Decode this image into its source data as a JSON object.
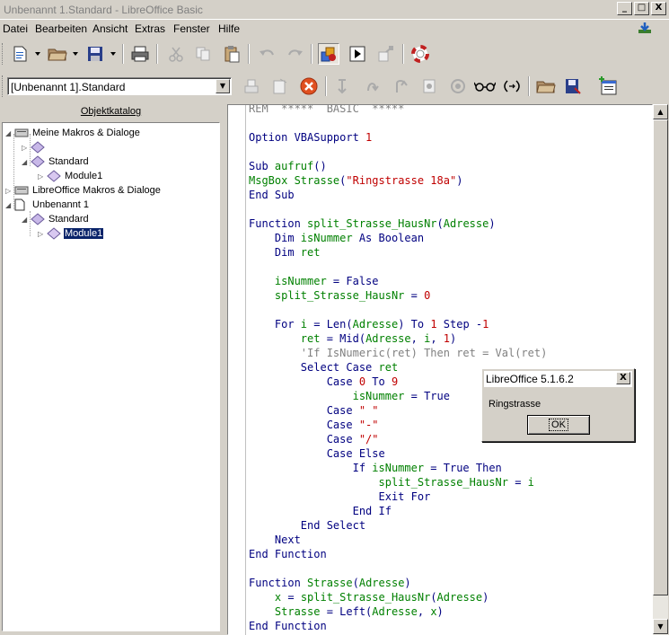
{
  "window": {
    "title": "Unbenannt 1.Standard - LibreOffice Basic",
    "controls": {
      "minimize": "_",
      "maximize": "□",
      "close": "X"
    }
  },
  "menubar": {
    "items": [
      {
        "label": "Datei"
      },
      {
        "label": "Bearbeiten"
      },
      {
        "label": "Ansicht"
      },
      {
        "label": "Extras"
      },
      {
        "label": "Fenster"
      },
      {
        "label": "Hilfe"
      }
    ]
  },
  "library_selector": {
    "value": "[Unbenannt 1].Standard"
  },
  "object_catalog": {
    "title": "Objektkatalog",
    "tree": [
      {
        "label": "Meine Makros & Dialoge",
        "level": 0
      },
      {
        "label": "",
        "level": 1
      },
      {
        "label": "Standard",
        "level": 1
      },
      {
        "label": "Module1",
        "level": 2
      },
      {
        "label": "LibreOffice Makros & Dialoge",
        "level": 0
      },
      {
        "label": "Unbenannt 1",
        "level": 0
      },
      {
        "label": "Standard",
        "level": 1
      },
      {
        "label": "Module1",
        "level": 2,
        "selected": true
      }
    ]
  },
  "code": [
    [
      {
        "t": "cmt",
        "v": "REM  *****  BASIC  *****"
      }
    ],
    [],
    [
      {
        "t": "kw",
        "v": "Option VBASupport "
      },
      {
        "t": "num",
        "v": "1"
      }
    ],
    [],
    [
      {
        "t": "kw",
        "v": "Sub "
      },
      {
        "t": "idf",
        "v": "aufruf"
      },
      {
        "t": "kw",
        "v": "()"
      }
    ],
    [
      {
        "t": "idf",
        "v": "MsgBox Strasse"
      },
      {
        "t": "kw",
        "v": "("
      },
      {
        "t": "str",
        "v": "\"Ringstrasse 18a\""
      },
      {
        "t": "kw",
        "v": ")"
      }
    ],
    [
      {
        "t": "kw",
        "v": "End Sub"
      }
    ],
    [],
    [
      {
        "t": "kw",
        "v": "Function "
      },
      {
        "t": "idf",
        "v": "split_Strasse_HausNr"
      },
      {
        "t": "kw",
        "v": "("
      },
      {
        "t": "idf",
        "v": "Adresse"
      },
      {
        "t": "kw",
        "v": ")"
      }
    ],
    [
      {
        "t": "kw",
        "v": "    Dim "
      },
      {
        "t": "idf",
        "v": "isNummer"
      },
      {
        "t": "kw",
        "v": " As Boolean"
      }
    ],
    [
      {
        "t": "kw",
        "v": "    Dim "
      },
      {
        "t": "idf",
        "v": "ret"
      }
    ],
    [],
    [
      {
        "t": "idf",
        "v": "    isNummer"
      },
      {
        "t": "kw",
        "v": " = False"
      }
    ],
    [
      {
        "t": "idf",
        "v": "    split_Strasse_HausNr"
      },
      {
        "t": "kw",
        "v": " = "
      },
      {
        "t": "num",
        "v": "0"
      }
    ],
    [],
    [
      {
        "t": "kw",
        "v": "    For "
      },
      {
        "t": "idf",
        "v": "i"
      },
      {
        "t": "kw",
        "v": " = Len("
      },
      {
        "t": "idf",
        "v": "Adresse"
      },
      {
        "t": "kw",
        "v": ") To "
      },
      {
        "t": "num",
        "v": "1"
      },
      {
        "t": "kw",
        "v": " Step -"
      },
      {
        "t": "num",
        "v": "1"
      }
    ],
    [
      {
        "t": "idf",
        "v": "        ret"
      },
      {
        "t": "kw",
        "v": " = Mid("
      },
      {
        "t": "idf",
        "v": "Adresse"
      },
      {
        "t": "kw",
        "v": ", "
      },
      {
        "t": "idf",
        "v": "i"
      },
      {
        "t": "kw",
        "v": ", "
      },
      {
        "t": "num",
        "v": "1"
      },
      {
        "t": "kw",
        "v": ")"
      }
    ],
    [
      {
        "t": "cmt",
        "v": "        'If IsNumeric(ret) Then ret = Val(ret)"
      }
    ],
    [
      {
        "t": "kw",
        "v": "        Select Case "
      },
      {
        "t": "idf",
        "v": "ret"
      }
    ],
    [
      {
        "t": "kw",
        "v": "            Case "
      },
      {
        "t": "num",
        "v": "0"
      },
      {
        "t": "kw",
        "v": " To "
      },
      {
        "t": "num",
        "v": "9"
      }
    ],
    [
      {
        "t": "idf",
        "v": "                isNummer"
      },
      {
        "t": "kw",
        "v": " = True"
      }
    ],
    [
      {
        "t": "kw",
        "v": "            Case "
      },
      {
        "t": "str",
        "v": "\" \""
      }
    ],
    [
      {
        "t": "kw",
        "v": "            Case "
      },
      {
        "t": "str",
        "v": "\"-\""
      }
    ],
    [
      {
        "t": "kw",
        "v": "            Case "
      },
      {
        "t": "str",
        "v": "\"/\""
      }
    ],
    [
      {
        "t": "kw",
        "v": "            Case Else"
      }
    ],
    [
      {
        "t": "kw",
        "v": "                If "
      },
      {
        "t": "idf",
        "v": "isNummer"
      },
      {
        "t": "kw",
        "v": " = True Then"
      }
    ],
    [
      {
        "t": "idf",
        "v": "                    split_Strasse_HausNr"
      },
      {
        "t": "kw",
        "v": " = "
      },
      {
        "t": "idf",
        "v": "i"
      }
    ],
    [
      {
        "t": "kw",
        "v": "                    Exit For"
      }
    ],
    [
      {
        "t": "kw",
        "v": "                End If"
      }
    ],
    [
      {
        "t": "kw",
        "v": "        End Select"
      }
    ],
    [
      {
        "t": "kw",
        "v": "    Next"
      }
    ],
    [
      {
        "t": "kw",
        "v": "End Function"
      }
    ],
    [],
    [
      {
        "t": "kw",
        "v": "Function "
      },
      {
        "t": "idf",
        "v": "Strasse"
      },
      {
        "t": "kw",
        "v": "("
      },
      {
        "t": "idf",
        "v": "Adresse"
      },
      {
        "t": "kw",
        "v": ")"
      }
    ],
    [
      {
        "t": "idf",
        "v": "    x"
      },
      {
        "t": "kw",
        "v": " = "
      },
      {
        "t": "idf",
        "v": "split_Strasse_HausNr"
      },
      {
        "t": "kw",
        "v": "("
      },
      {
        "t": "idf",
        "v": "Adresse"
      },
      {
        "t": "kw",
        "v": ")"
      }
    ],
    [
      {
        "t": "idf",
        "v": "    Strasse"
      },
      {
        "t": "kw",
        "v": " = Left("
      },
      {
        "t": "idf",
        "v": "Adresse"
      },
      {
        "t": "kw",
        "v": ", "
      },
      {
        "t": "idf",
        "v": "x"
      },
      {
        "t": "kw",
        "v": ")"
      }
    ],
    [
      {
        "t": "kw",
        "v": "End Function"
      }
    ]
  ],
  "msgbox": {
    "title": "LibreOffice 5.1.6.2",
    "message": "Ringstrasse",
    "ok_label": "OK",
    "close_label": "X"
  },
  "colors": {
    "keyword": "#000080",
    "identifier": "#008000",
    "literal": "#c00000",
    "comment": "#808080",
    "selection": "#0a246a"
  }
}
